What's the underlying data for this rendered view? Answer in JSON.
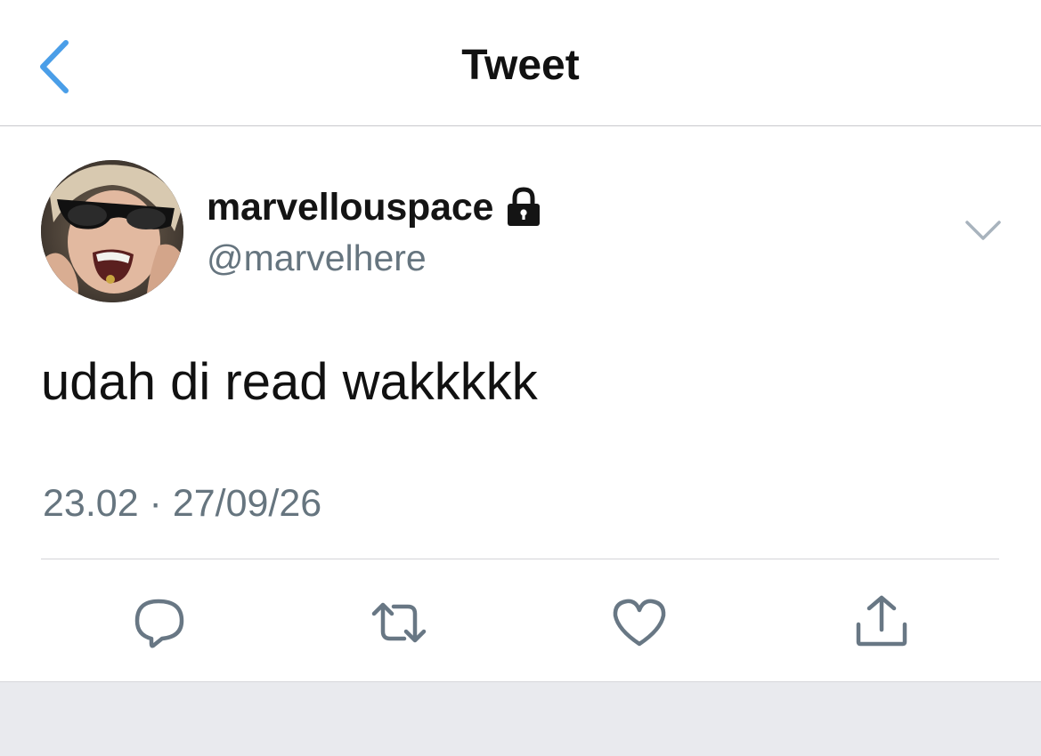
{
  "navbar": {
    "title": "Tweet",
    "back_icon": "chevron-left-icon",
    "accent_color": "#4a9ee8"
  },
  "tweet": {
    "display_name": "marvellouspace",
    "protected_icon": "lock-icon",
    "handle": "@marvelhere",
    "text": "udah di read wakkkkk",
    "timestamp": "23.02 · 27/09/26",
    "menu_icon": "chevron-down-icon"
  },
  "actions": [
    {
      "name": "reply",
      "icon": "reply-icon"
    },
    {
      "name": "retweet",
      "icon": "retweet-icon"
    },
    {
      "name": "like",
      "icon": "heart-icon"
    },
    {
      "name": "share",
      "icon": "share-icon"
    }
  ],
  "colors": {
    "icon_gray": "#687784",
    "text_secondary": "#66757f",
    "text_primary": "#111111",
    "bottom_bg": "#e9eaee"
  }
}
